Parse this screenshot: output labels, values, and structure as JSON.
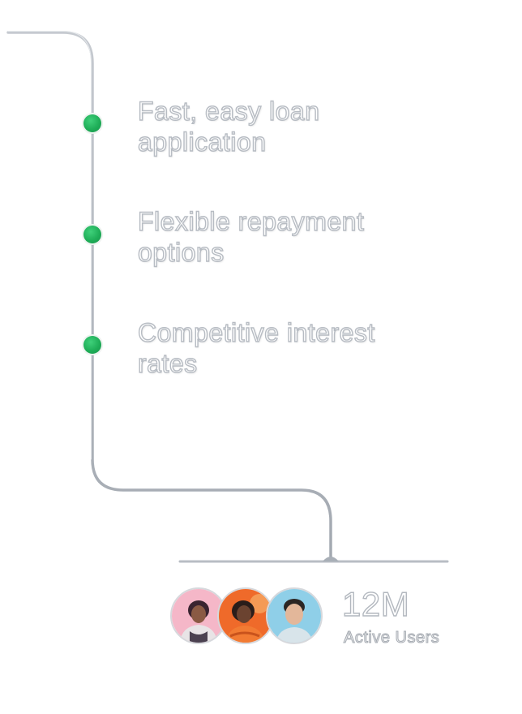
{
  "features": [
    {
      "text": "Fast, easy loan application"
    },
    {
      "text": "Flexible repayment options"
    },
    {
      "text": "Competitive interest rates"
    }
  ],
  "colors": {
    "dot": "#1fae58",
    "line": "#aab0b8",
    "text_outline": "#b7bcc3"
  },
  "users": {
    "avatars": [
      {
        "icon": "avatar-person-1"
      },
      {
        "icon": "avatar-person-2"
      },
      {
        "icon": "avatar-person-3"
      }
    ],
    "count": "12M",
    "label": "Active Users"
  }
}
